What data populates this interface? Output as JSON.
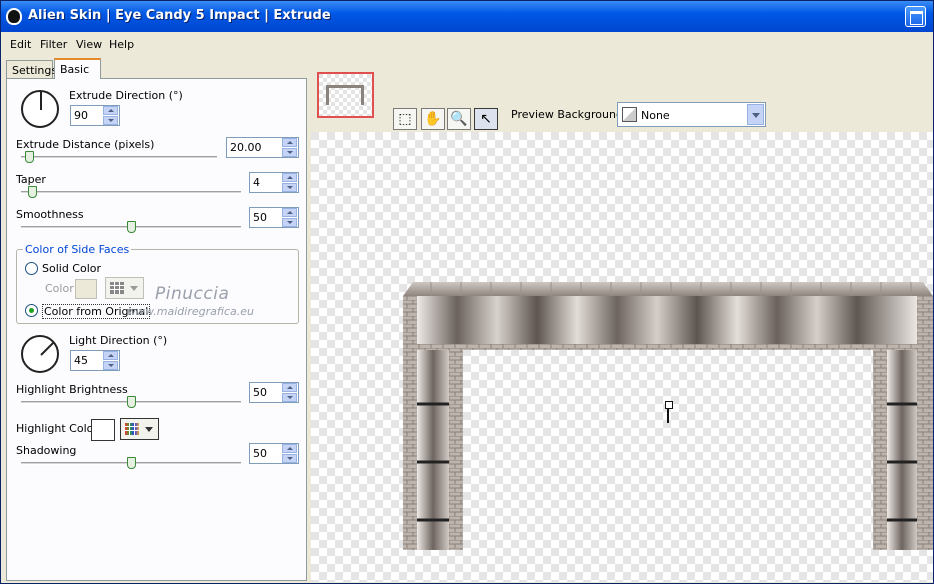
{
  "window": {
    "title": "Alien Skin  |  Eye Candy 5 Impact  |  Extrude"
  },
  "menu": [
    "Edit",
    "Filter",
    "View",
    "Help"
  ],
  "tabs": {
    "settings": "Settings",
    "basic": "Basic"
  },
  "controls": {
    "extrude_direction": {
      "label": "Extrude Direction (°)",
      "value": "90"
    },
    "extrude_distance": {
      "label": "Extrude Distance (pixels)",
      "value": "20.00",
      "slider": 0.04
    },
    "taper": {
      "label": "Taper",
      "value": "4",
      "slider": 0.05
    },
    "smoothness": {
      "label": "Smoothness",
      "value": "50",
      "slider": 0.5
    },
    "side_faces": {
      "legend": "Color of Side Faces",
      "solid": "Solid Color",
      "color_label": "Color",
      "from_original": "Color from Original"
    },
    "light_direction": {
      "label": "Light Direction (°)",
      "value": "45"
    },
    "highlight_brightness": {
      "label": "Highlight Brightness",
      "value": "50",
      "slider": 0.5
    },
    "highlight_color": {
      "label": "Highlight Color"
    },
    "shadowing": {
      "label": "Shadowing",
      "value": "50",
      "slider": 0.5
    }
  },
  "watermark": {
    "name": "Pinuccia",
    "site": "www.maidiregrafica.eu"
  },
  "preview": {
    "background_label": "Preview Background:",
    "background_value": "None"
  },
  "icons": [
    "app-icon",
    "maximize-icon",
    "navigator-icon",
    "hand-icon",
    "zoom-icon",
    "pointer-icon"
  ],
  "colors": {
    "title_bar": "#0058e6",
    "accent_tab": "#e68b2c",
    "frame_stone": "#a69c94",
    "legend": "#0046d5"
  }
}
